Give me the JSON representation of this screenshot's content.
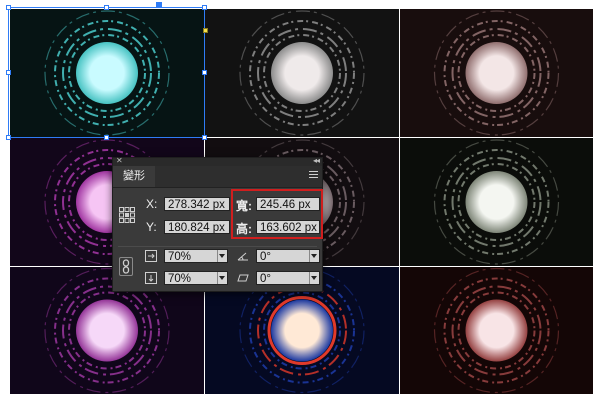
{
  "canvas": {
    "tiles": [
      {
        "ring": "#4fd6d6",
        "core": "#c9fbff",
        "bg": "#061414"
      },
      {
        "ring": "#9a9a9a",
        "core": "#efeaea",
        "bg": "#121212"
      },
      {
        "ring": "#9e7a7a",
        "core": "#f3e6e6",
        "bg": "#180d0d"
      },
      {
        "ring": "#b03bb0",
        "core": "#f6c5f4",
        "bg": "#12061a"
      },
      {
        "ring": "#7f6f74",
        "core": "#ece3e6",
        "bg": "#120d10"
      },
      {
        "ring": "#8b9384",
        "core": "#f4f6f1",
        "bg": "#0b0d0a"
      },
      {
        "ring": "#a33aa6",
        "core": "#f6d8f8",
        "bg": "#10061a"
      },
      {
        "ring": "#1f3fb0",
        "core": "#ffe9d6",
        "bg": "#050922",
        "accent": "#e03a2a"
      },
      {
        "ring": "#a34848",
        "core": "#f8e4e6",
        "bg": "#140606"
      }
    ]
  },
  "panel": {
    "tab_label": "變形",
    "x_label": "X:",
    "x_value": "278.342 px",
    "y_label": "Y:",
    "y_value": "180.824 px",
    "w_label": "寬:",
    "w_value": "245.46 px",
    "h_label": "高:",
    "h_value": "163.602 px",
    "scale_w": "70%",
    "scale_h": "70%",
    "rotate": "0°",
    "shear": "0°"
  },
  "colors": {
    "highlight": "#d01e1e",
    "selection": "#2f7cf6"
  }
}
